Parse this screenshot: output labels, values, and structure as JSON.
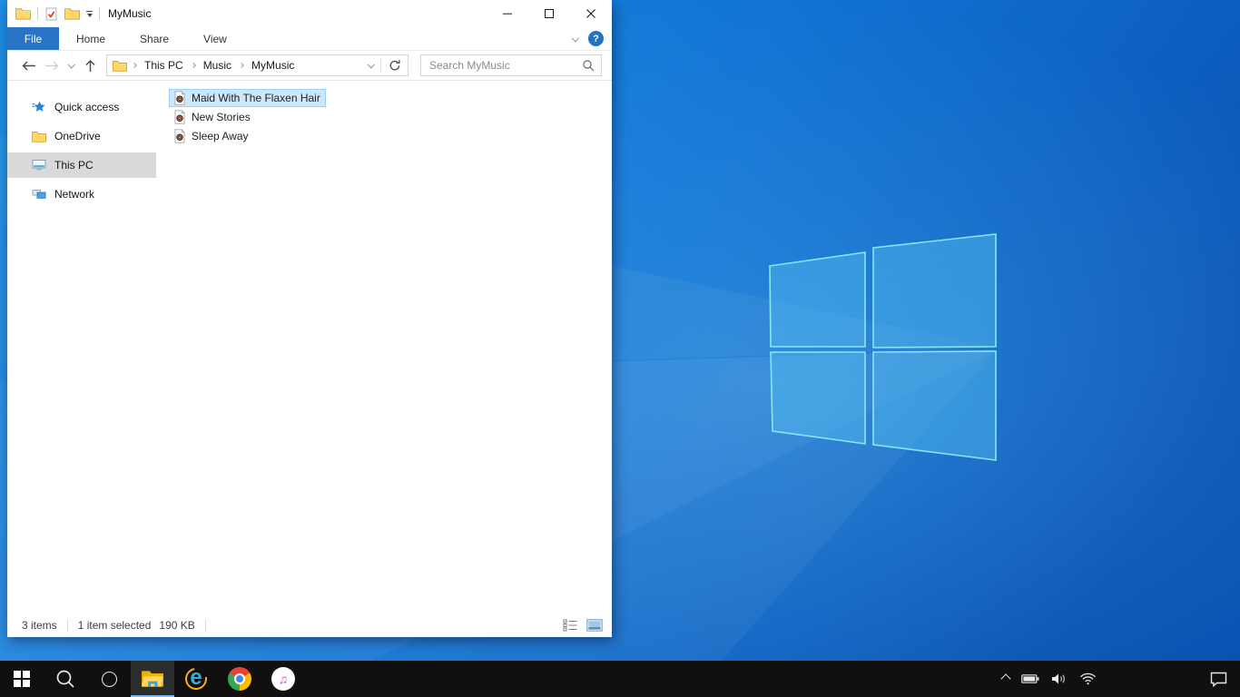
{
  "window": {
    "title": "MyMusic",
    "tabs": [
      {
        "label": "File",
        "active": true
      },
      {
        "label": "Home",
        "active": false
      },
      {
        "label": "Share",
        "active": false
      },
      {
        "label": "View",
        "active": false
      }
    ],
    "nav": {
      "crumbs": [
        "This PC",
        "Music",
        "MyMusic"
      ],
      "search_placeholder": "Search MyMusic"
    },
    "sidebar": {
      "items": [
        {
          "label": "Quick access",
          "icon": "star-icon",
          "selected": false
        },
        {
          "label": "OneDrive",
          "icon": "folder-icon",
          "selected": false
        },
        {
          "label": "This PC",
          "icon": "monitor-icon",
          "selected": true
        },
        {
          "label": "Network",
          "icon": "network-icon",
          "selected": false
        }
      ]
    },
    "files": {
      "items": [
        {
          "name": "Maid With The Flaxen Hair",
          "icon": "music-file-icon",
          "selected": true
        },
        {
          "name": "New Stories",
          "icon": "music-file-icon",
          "selected": false
        },
        {
          "name": "Sleep Away",
          "icon": "music-file-icon",
          "selected": false
        }
      ]
    },
    "status": {
      "items_count": "3 items",
      "selection": "1 item selected",
      "selection_size": "190 KB"
    }
  },
  "taskbar": {
    "apps": [
      "start",
      "search",
      "cortana",
      "file-explorer (active)",
      "internet-explorer",
      "chrome",
      "itunes"
    ],
    "tray": [
      "hidden-icons-chevron",
      "battery",
      "volume",
      "wifi",
      "action-center"
    ]
  },
  "colors": {
    "file_tab_blue": "#2874c6",
    "selection_bg": "#cce8ff",
    "selection_border": "#99d1ff",
    "sidebar_selected_bg": "#d9d9d9",
    "taskbar_bg": "#101010",
    "taskbar_active_underline": "#76b9ed",
    "wallpaper_light": "#1b8fe6",
    "wallpaper_dark": "#0a52b2"
  }
}
